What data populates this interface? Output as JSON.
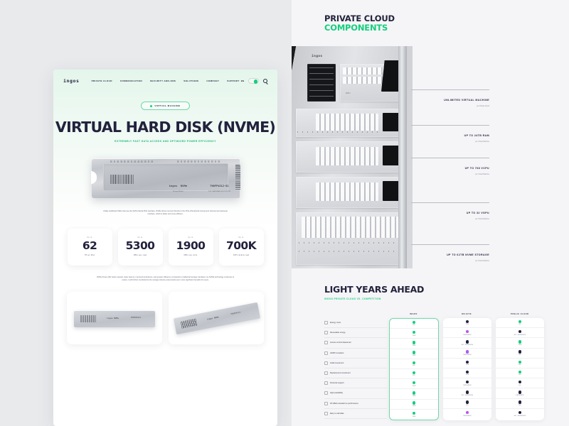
{
  "left_page": {
    "logo": "ingos",
    "nav": [
      "PRIVATE CLOUD",
      "COMMUNICATION",
      "SECURITY ADD-ONS",
      "SOLUTIONS",
      "COMPANY",
      "SUPPORT"
    ],
    "lang": "EN",
    "pill_label": "VIRTUAL MACHINE",
    "hero_title": "VIRTUAL HARD DISK (NVME)",
    "hero_subtitle": "EXTREMELY FAST DATA ACCESS AND OPTIMIZED POWER EFFICIENCY",
    "product": {
      "brand": "ingos",
      "model": "NVMe",
      "brand_sub": "Storage Module",
      "code": "TH8FP4S12-G1",
      "code_sub": "S.M. / HARDWARE ENCRYPTION"
    },
    "body_copy": "Unlike traditional SSDs that use the SATA (Serial ATA) interface, NVMe drives connect directly to the PCIe (Peripheral Component Interconnect Express) interface, which is faster and more efficient.",
    "stats": [
      {
        "upto": "Up to",
        "value": "62",
        "caption": "TB per Disk"
      },
      {
        "upto": "Up to",
        "value": "5300",
        "caption": "MB/s seq. read"
      },
      {
        "upto": "Up to",
        "value": "1900",
        "caption": "MB/s seq. write"
      },
      {
        "upto": "Up to",
        "value": "700K",
        "caption": "IOPS random read"
      }
    ],
    "body_copy2": "NVMe drives offer faster speeds, lower latency, improved endurance, and greater efficiency compared to traditional storage interfaces. As NVMe technology continues to evolve, it will further revolutionize the storage industry and provide even more significant benefits for users.",
    "cards": [
      {
        "label": "ingos NVMe",
        "code": "TH8FP4S12"
      },
      {
        "label": "ingos NVMe",
        "code": "TH8FP4S12"
      }
    ]
  },
  "right_panel": {
    "heading_line1": "PRIVATE CLOUD",
    "heading_line2": "COMPONENTS",
    "server_logo": "ingos",
    "server_unit_label": "GPU",
    "annotations": [
      {
        "title": "UNLIMITED VIRTUAL MACHINE",
        "sub": "per Private Cloud"
      },
      {
        "title": "UP TO 24TB RAM",
        "sub": "per Virtual Machine"
      },
      {
        "title": "UP TO 768 VCPU",
        "sub": "per Virtual Machine"
      },
      {
        "title": "UP TO 32 VGPU",
        "sub": "per Virtual Machine"
      },
      {
        "title": "UP TO 62TB NVME STORAGE",
        "sub": "per Virtual Machine"
      }
    ],
    "comparison": {
      "title": "LIGHT YEARS AHEAD",
      "subtitle": "INGOS PRIVATE CLOUD VS. COMPETITION",
      "columns": [
        "INGOS",
        "ON-SITE",
        "PUBLIC CLOUD"
      ],
      "rows": [
        {
          "label": "Energy costs",
          "icon": "plug-icon",
          "values": [
            {
              "dot": "g",
              "text": "NO"
            },
            {
              "dot": "d",
              "text": "YES"
            },
            {
              "dot": "g",
              "text": "NO"
            }
          ]
        },
        {
          "label": "Renewable energy",
          "icon": "leaf-icon",
          "values": [
            {
              "dot": "g",
              "text": "YES"
            },
            {
              "dot": "p",
              "text": "DEPENDS"
            },
            {
              "dot": "d",
              "text": "NO, DEPENDS"
            }
          ]
        },
        {
          "label": "Access control datacenter",
          "icon": "fingerprint-icon",
          "values": [
            {
              "dot": "g",
              "text": "YES"
            },
            {
              "dot": "d",
              "text": "NO, DEPENDS"
            },
            {
              "dot": "g",
              "text": "YES"
            }
          ]
        },
        {
          "label": "GDPR compliant",
          "icon": "shield-icon",
          "values": [
            {
              "dot": "g",
              "text": "YES"
            },
            {
              "dot": "p",
              "text": "DEPENDS"
            },
            {
              "dot": "d",
              "text": "NO"
            }
          ]
        },
        {
          "label": "Initial investment",
          "icon": "chart-icon",
          "values": [
            {
              "dot": "g",
              "text": "NO"
            },
            {
              "dot": "d",
              "text": "YES"
            },
            {
              "dot": "g",
              "text": "NO"
            }
          ]
        },
        {
          "label": "Replacement investment",
          "icon": "bars-icon",
          "values": [
            {
              "dot": "g",
              "text": "NO"
            },
            {
              "dot": "d",
              "text": "YES"
            },
            {
              "dot": "g",
              "text": "NO"
            }
          ]
        },
        {
          "label": "Personal support",
          "icon": "headset-icon",
          "values": [
            {
              "dot": "g",
              "text": "YES"
            },
            {
              "dot": "d",
              "text": "DEPENDS"
            },
            {
              "dot": "d",
              "text": "NO"
            }
          ]
        },
        {
          "label": "High availability",
          "icon": "clock-icon",
          "values": [
            {
              "dot": "g",
              "text": "YES"
            },
            {
              "dot": "d",
              "text": "NO, DEPENDS"
            },
            {
              "dot": "d",
              "text": "DEPENDS"
            }
          ]
        },
        {
          "label": "25 GBit/s standard re performance",
          "icon": "speed-icon",
          "values": [
            {
              "dot": "g",
              "text": "YES"
            },
            {
              "dot": "d",
              "text": "NO"
            },
            {
              "dot": "d",
              "text": "NO"
            }
          ]
        },
        {
          "label": "Easy to calculate",
          "icon": "calculator-icon",
          "values": [
            {
              "dot": "g",
              "text": "YES"
            },
            {
              "dot": "p",
              "text": "DEPENDS"
            },
            {
              "dot": "d",
              "text": "NO, DEPENDS"
            }
          ]
        }
      ]
    }
  }
}
